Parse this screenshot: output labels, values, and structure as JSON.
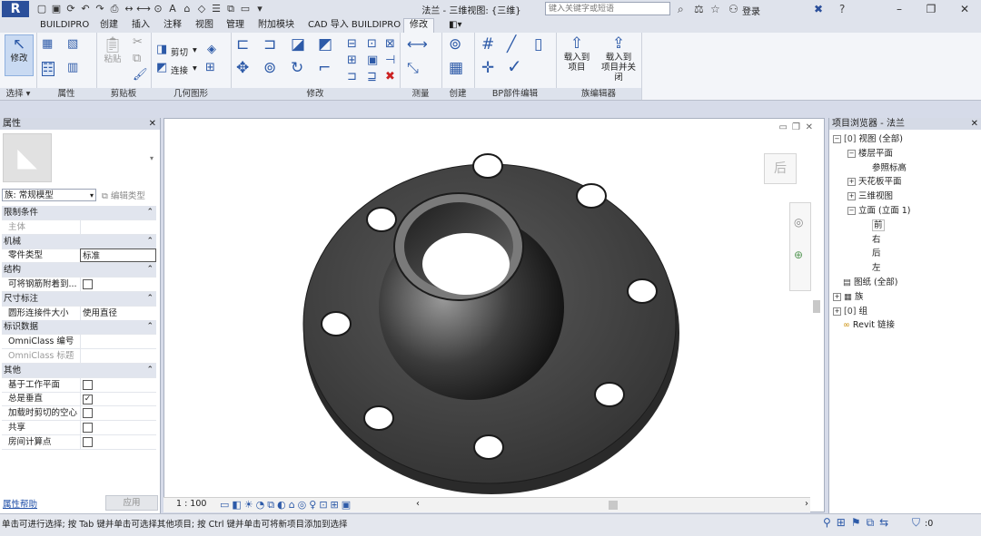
{
  "titlebar": {
    "app_logo": "R",
    "title": "法兰 - 三维视图: {三维}",
    "search_placeholder": "键入关键字或短语",
    "login_label": "登录",
    "qat_text_tool": "A"
  },
  "tabs": [
    "BUILDIPRO",
    "创建",
    "插入",
    "注释",
    "视图",
    "管理",
    "附加模块",
    "CAD 导入 BUILDIPRO",
    "修改"
  ],
  "ribbon": {
    "panels": {
      "select": "选择",
      "properties": "属性",
      "clipboard": "剪贴板",
      "geometry": "几何图形",
      "modify": "修改",
      "measure": "测量",
      "create": "创建",
      "bp_edit": "BP部件编辑",
      "family_editor": "族编辑器"
    },
    "buttons": {
      "modify": "修改",
      "paste": "粘贴",
      "cut": "剪切",
      "join": "连接",
      "load_into_project": "载入到\n项目",
      "load_and_close": "载入到\n项目并关闭"
    }
  },
  "properties": {
    "title": "属性",
    "family": "族: 常规模型",
    "edit_type": "编辑类型",
    "rows": [
      {
        "kind": "section",
        "label": "限制条件"
      },
      {
        "kind": "field",
        "label": "主体",
        "value": "",
        "dim": true
      },
      {
        "kind": "section",
        "label": "机械"
      },
      {
        "kind": "field",
        "label": "零件类型",
        "value": "标准"
      },
      {
        "kind": "section",
        "label": "结构"
      },
      {
        "kind": "check",
        "label": "可将钢筋附着到...",
        "checked": false
      },
      {
        "kind": "section",
        "label": "尺寸标注"
      },
      {
        "kind": "field",
        "label": "圆形连接件大小",
        "value": "使用直径"
      },
      {
        "kind": "section",
        "label": "标识数据"
      },
      {
        "kind": "field",
        "label": "OmniClass 编号",
        "value": ""
      },
      {
        "kind": "field",
        "label": "OmniClass 标题",
        "value": "",
        "dim": true
      },
      {
        "kind": "section",
        "label": "其他"
      },
      {
        "kind": "check",
        "label": "基于工作平面",
        "checked": false
      },
      {
        "kind": "check",
        "label": "总是垂直",
        "checked": true
      },
      {
        "kind": "check",
        "label": "加载时剪切的空心",
        "checked": false
      },
      {
        "kind": "check",
        "label": "共享",
        "checked": false
      },
      {
        "kind": "check",
        "label": "房间计算点",
        "checked": false
      }
    ],
    "help_link": "属性帮助",
    "apply": "应用"
  },
  "viewport": {
    "view_cube_label": "后",
    "scale": "1 : 100"
  },
  "browser": {
    "title": "项目浏览器 - 法兰",
    "nodes": [
      {
        "level": 0,
        "toggle": "−",
        "icon": "[0]",
        "label": "视图 (全部)"
      },
      {
        "level": 1,
        "toggle": "−",
        "icon": "",
        "label": "楼层平面"
      },
      {
        "level": 2,
        "toggle": "",
        "icon": "",
        "label": "参照标高"
      },
      {
        "level": 1,
        "toggle": "+",
        "icon": "",
        "label": "天花板平面"
      },
      {
        "level": 1,
        "toggle": "+",
        "icon": "",
        "label": "三维视图"
      },
      {
        "level": 1,
        "toggle": "−",
        "icon": "",
        "label": "立面 (立面 1)"
      },
      {
        "level": 2,
        "toggle": "",
        "icon": "",
        "label": "前"
      },
      {
        "level": 2,
        "toggle": "",
        "icon": "",
        "label": "右"
      },
      {
        "level": 2,
        "toggle": "",
        "icon": "",
        "label": "后"
      },
      {
        "level": 2,
        "toggle": "",
        "icon": "",
        "label": "左"
      },
      {
        "level": 0,
        "toggle": "",
        "icon": "▤",
        "label": "图纸 (全部)"
      },
      {
        "level": 0,
        "toggle": "+",
        "icon": "▦",
        "label": "族"
      },
      {
        "level": 0,
        "toggle": "+",
        "icon": "[0]",
        "label": "组"
      },
      {
        "level": 0,
        "toggle": "",
        "icon": "∞",
        "label": "Revit 链接"
      }
    ]
  },
  "statusbar": {
    "text": "单击可进行选择; 按 Tab 键并单击可选择其他项目; 按 Ctrl 键并单击可将新项目添加到选择",
    "filter_count": ":0"
  },
  "colors": {
    "accent": "#2d5aa8",
    "viewport_bg": "#ffffff",
    "flange": "#4a4a4a"
  }
}
